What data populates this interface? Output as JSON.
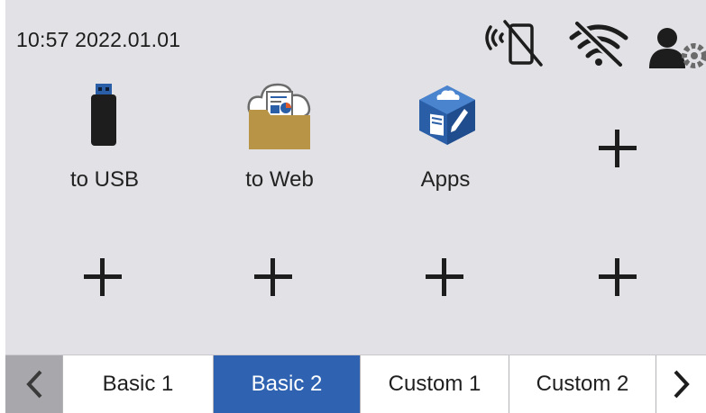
{
  "status": {
    "datetime": "10:57 2022.01.01",
    "icons": [
      "nfc-off-icon",
      "wifi-off-icon",
      "user-settings-icon"
    ]
  },
  "shortcuts": [
    {
      "label": "to USB",
      "icon": "usb-drive-icon"
    },
    {
      "label": "to Web",
      "icon": "web-folder-icon"
    },
    {
      "label": "Apps",
      "icon": "apps-cube-icon"
    }
  ],
  "tabs": [
    {
      "label": "Basic 1",
      "active": false
    },
    {
      "label": "Basic 2",
      "active": true
    },
    {
      "label": "Custom 1",
      "active": false
    },
    {
      "label": "Custom 2",
      "active": false
    }
  ],
  "colors": {
    "screen_bg": "#e2e2e6",
    "active_tab": "#2f63b1",
    "apps_blue": "#2a5fa8",
    "folder_gold": "#b89446"
  }
}
